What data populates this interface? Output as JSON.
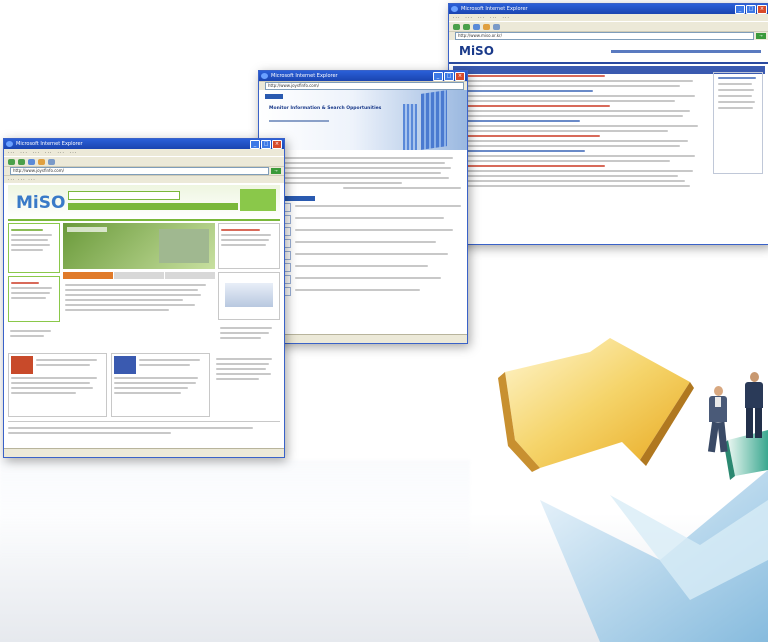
{
  "ie_title": "Microsoft Internet Explorer",
  "site": {
    "logo": "MiSO",
    "tagline_title": "Monitor Information & Search Opportunities"
  },
  "window_back": {
    "url": "http://www.miso.or.kr/"
  },
  "window_middle": {
    "url": "http://www.joysfinfo.com/"
  },
  "window_front": {
    "url": "http://www.joysfinfo.com/"
  },
  "icons": [
    "ie-icon",
    "back-icon",
    "forward-icon",
    "refresh-icon",
    "home-icon",
    "search-icon",
    "arrow-graphic",
    "businessman-figure"
  ]
}
